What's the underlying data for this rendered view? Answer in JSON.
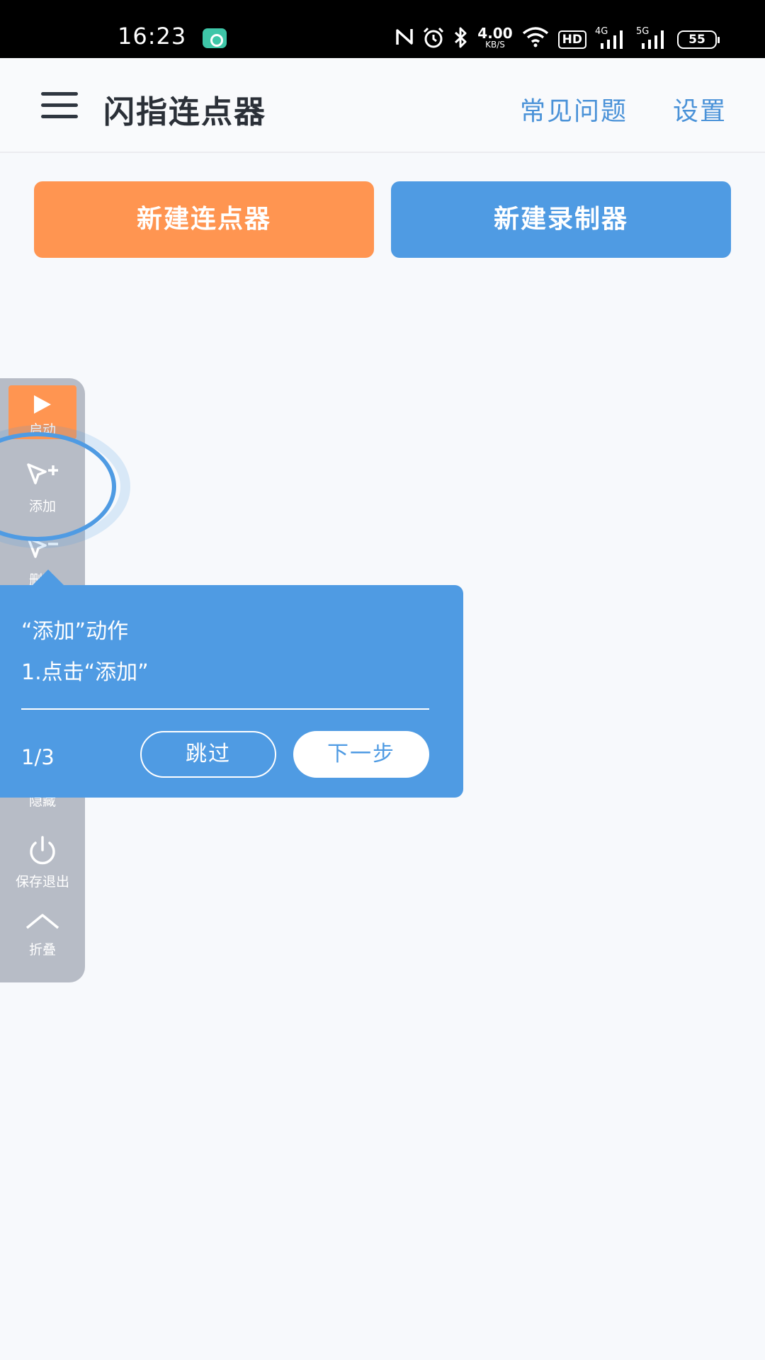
{
  "status_bar": {
    "time": "16:23",
    "net_speed_value": "4.00",
    "net_speed_unit": "KB/S",
    "hd_badge": "HD",
    "signal1_label": "4G",
    "signal2_label": "5G",
    "battery": "55",
    "icons": [
      "notification-app-icon",
      "nfc-icon",
      "alarm-icon",
      "bluetooth-icon",
      "wifi-icon",
      "signal-icon",
      "battery-icon"
    ]
  },
  "app_bar": {
    "title": "闪指连点器",
    "faq_label": "常见问题",
    "settings_label": "设置"
  },
  "actions": {
    "new_clicker": "新建连点器",
    "new_recorder": "新建录制器"
  },
  "toolbar": {
    "start": "启动",
    "add": "添加",
    "remove": "删除",
    "hide": "隐藏",
    "save_exit": "保存退出",
    "collapse": "折叠"
  },
  "tooltip": {
    "title": "“添加”动作",
    "step": "1.点击“添加”",
    "counter": "1/3",
    "skip": "跳过",
    "next": "下一步"
  },
  "colors": {
    "orange": "#ff9551",
    "blue": "#4f9be3",
    "toolbar_gray": "#b7bcc6",
    "title_text": "#2b3038",
    "link_text": "#4a92d8"
  }
}
